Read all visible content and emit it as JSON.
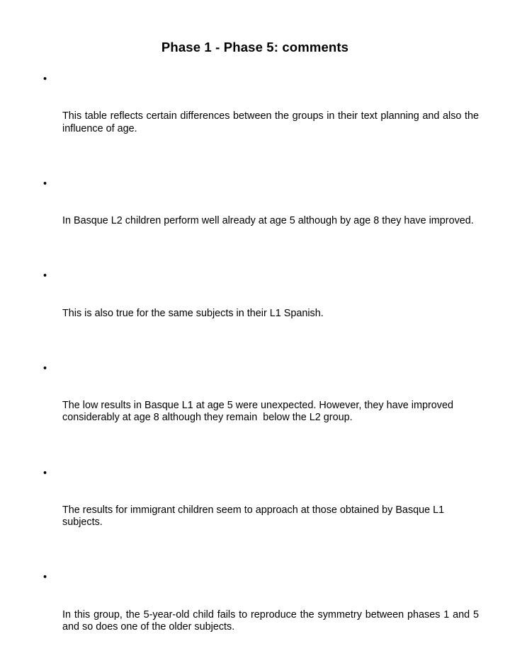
{
  "slide": {
    "background_color": "#ffffff",
    "text_color": "#000000",
    "title": "Phase 1 - Phase 5: comments",
    "bullet_marker": "•",
    "bullets": [
      {
        "id": "bullet-1",
        "text": "This table reflects certain differences between the groups in their text planning and also the influence of age.",
        "lines": 2
      },
      {
        "id": "bullet-2",
        "text": "In Basque L2 children perform well already at age 5 although by age 8 they have improved.",
        "lines": 2
      },
      {
        "id": "bullet-3",
        "text": "This is also true for the same subjects in their L1 Spanish.",
        "lines": 1
      },
      {
        "id": "bullet-4",
        "text": "The low results in Basque L1 at age 5 were unexpected. However, they have improved considerably at age 8 although they remain  below the L2 group.",
        "lines": 3
      },
      {
        "id": "bullet-5",
        "text": "The results for immigrant children seem to approach at those obtained by Basque L1 subjects.",
        "lines": 2
      },
      {
        "id": "bullet-6",
        "text": "In this group, the 5-year-old child fails to reproduce the symmetry between phases 1 and 5 and so does one of the older subjects.",
        "lines": 2
      }
    ]
  }
}
